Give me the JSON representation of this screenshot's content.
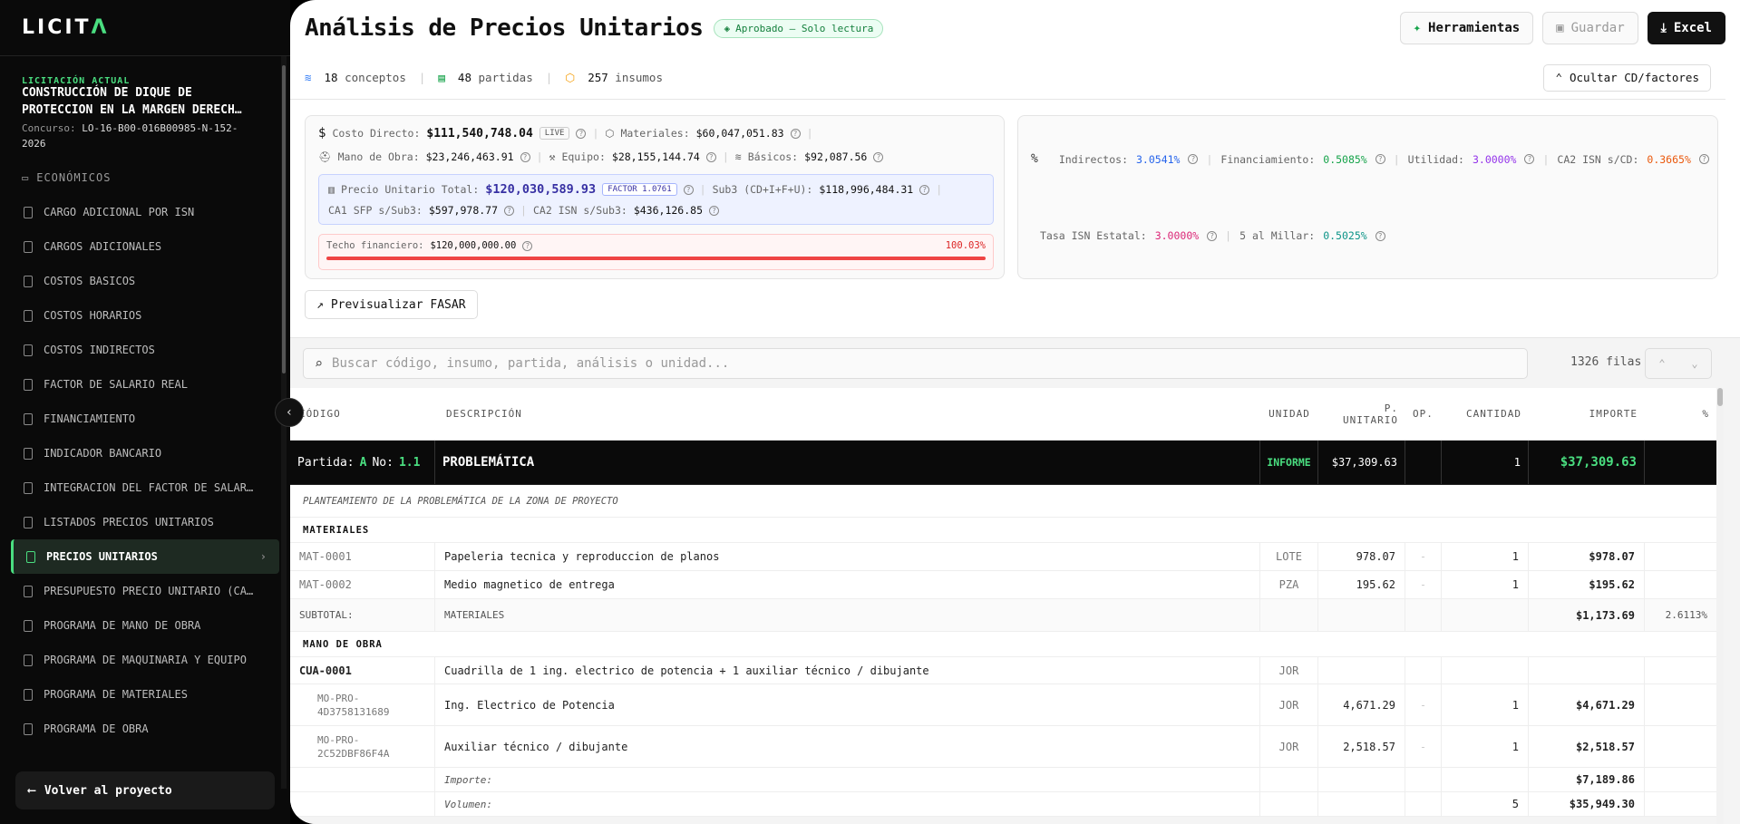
{
  "sidebar": {
    "logo": "LICITA",
    "licit_label": "LICITACIÓN ACTUAL",
    "licit_title1": "CONSTRUCCIÓN DE DIQUE DE",
    "licit_title2": "PROTECCIÓN EN LA MARGEN DERECH…",
    "concurso_label": "Concurso:",
    "concurso_value1": "LO-16-B00-016B00985-N-152-",
    "concurso_value2": "2026",
    "section": "ECONÓMICOS",
    "items": [
      "CARGO ADICIONAL POR ISN",
      "CARGOS ADICIONALES",
      "COSTOS BASICOS",
      "COSTOS HORARIOS",
      "COSTOS INDIRECTOS",
      "FACTOR DE SALARIO REAL",
      "FINANCIAMIENTO",
      "INDICADOR BANCARIO",
      "INTEGRACION DEL FACTOR DE SALAR…",
      "LISTADOS PRECIOS UNITARIOS",
      "PRECIOS UNITARIOS",
      "PRESUPUESTO PRECIO UNITARIO (CA…",
      "PROGRAMA DE MANO DE OBRA",
      "PROGRAMA DE MAQUINARIA Y EQUIPO",
      "PROGRAMA DE MATERIALES",
      "PROGRAMA DE OBRA"
    ],
    "back": "Volver al proyecto"
  },
  "header": {
    "title": "Análisis de Precios Unitarios",
    "badge": "Aprobado — Solo lectura",
    "tools": "Herramientas",
    "save": "Guardar",
    "excel": "Excel"
  },
  "stats": {
    "conceptos": "18",
    "conceptos_l": "conceptos",
    "partidas": "48",
    "partidas_l": "partidas",
    "insumos": "257",
    "insumos_l": "insumos",
    "toggle": "Ocultar CD/factores"
  },
  "costs": {
    "cd_l": "Costo Directo:",
    "cd": "$111,540,748.04",
    "live": "LIVE",
    "mat_l": "Materiales:",
    "mat": "$60,047,051.83",
    "mo_l": "Mano de Obra:",
    "mo": "$23,246,463.91",
    "eq_l": "Equipo:",
    "eq": "$28,155,144.74",
    "bas_l": "Básicos:",
    "bas": "$92,087.56",
    "pu_l": "Precio Unitario Total:",
    "pu": "$120,030,589.93",
    "factor": "FACTOR 1.0761",
    "sub3_l": "Sub3 (CD+I+F+U):",
    "sub3": "$118,996,484.31",
    "ca1_l": "CA1 SFP s/Sub3:",
    "ca1": "$597,978.77",
    "ca2_l": "CA2 ISN s/Sub3:",
    "ca2": "$436,126.85",
    "techo_l": "Techo financiero:",
    "techo": "$120,000,000.00",
    "techo_pct": "100.03%"
  },
  "factors": {
    "ind_l": "Indirectos:",
    "ind": "3.0541%",
    "fin_l": "Financiamiento:",
    "fin": "0.5085%",
    "uti_l": "Utilidad:",
    "uti": "3.0000%",
    "ca2_l": "CA2 ISN s/CD:",
    "ca2": "0.3665%",
    "isn_l": "Tasa ISN Estatal:",
    "isn": "3.0000%",
    "mil_l": "5 al Millar:",
    "mil": "0.5025%"
  },
  "fasar": "Previsualizar FASAR",
  "search": {
    "placeholder": "Buscar código, insumo, partida, análisis o unidad...",
    "rows": "1326 filas"
  },
  "table": {
    "headers": [
      "CÓDIGO",
      "DESCRIPCIÓN",
      "UNIDAD",
      "P. UNITARIO",
      "OP.",
      "CANTIDAD",
      "IMPORTE",
      "%"
    ],
    "partida": {
      "label": "Partida:",
      "letter": "A",
      "no_label": "No:",
      "no": "1.1",
      "title": "PROBLEMÁTICA",
      "unit": "INFORME",
      "pu": "$37,309.63",
      "qty": "1",
      "imp": "$37,309.63"
    },
    "desc": "PLANTEAMIENTO DE LA PROBLEMÁTICA DE LA ZONA DE PROYECTO",
    "sec_mat": "MATERIALES",
    "mat_rows": [
      {
        "code": "MAT-0001",
        "desc": "Papeleria tecnica y reproduccion de planos",
        "unit": "LOTE",
        "pu": "978.07",
        "op": "-",
        "qty": "1",
        "imp": "$978.07"
      },
      {
        "code": "MAT-0002",
        "desc": "Medio magnetico de entrega",
        "unit": "PZA",
        "pu": "195.62",
        "op": "-",
        "qty": "1",
        "imp": "$195.62"
      }
    ],
    "subtotal": {
      "code": "SUBTOTAL:",
      "desc": "MATERIALES",
      "imp": "$1,173.69",
      "pct": "2.6113%"
    },
    "sec_mo": "MANO DE OBRA",
    "cua": {
      "code": "CUA-0001",
      "desc": "Cuadrilla de 1 ing. electrico de potencia + 1 auxiliar técnico / dibujante",
      "unit": "JOR"
    },
    "mo_rows": [
      {
        "code1": "MO-PRO-",
        "code2": "4D3758131689",
        "desc": "Ing. Electrico de Potencia",
        "unit": "JOR",
        "pu": "4,671.29",
        "op": "-",
        "qty": "1",
        "imp": "$4,671.29"
      },
      {
        "code1": "MO-PRO-",
        "code2": "2C52DBF86F4A",
        "desc": "Auxiliar técnico / dibujante",
        "unit": "JOR",
        "pu": "2,518.57",
        "op": "-",
        "qty": "1",
        "imp": "$2,518.57"
      }
    ],
    "importe": {
      "label": "Importe:",
      "imp": "$7,189.86"
    },
    "volumen": {
      "label": "Volumen:",
      "qty": "5",
      "imp": "$35,949.30"
    }
  }
}
